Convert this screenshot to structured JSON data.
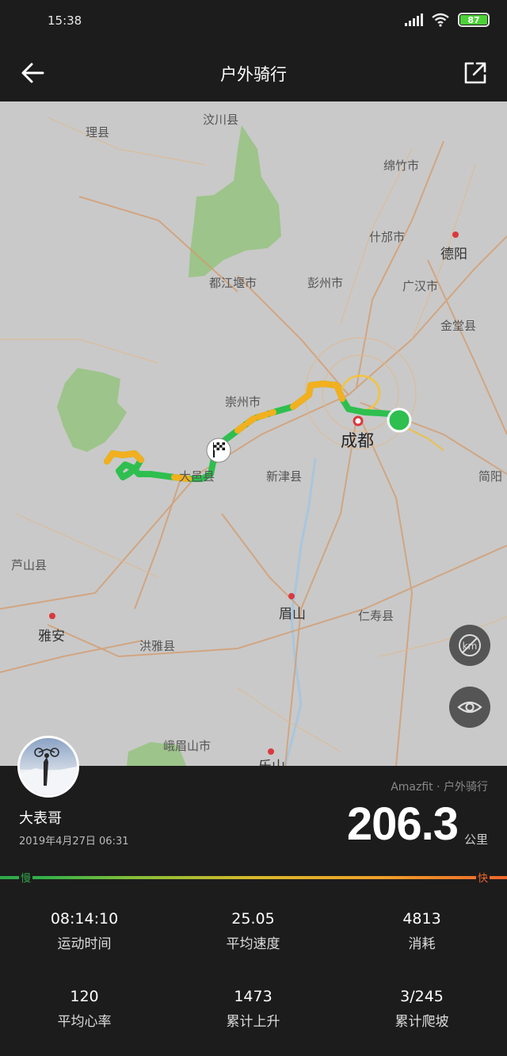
{
  "status": {
    "time": "15:38",
    "battery": "87"
  },
  "app_bar": {
    "title": "户外骑行"
  },
  "map": {
    "labels": {
      "lixian": "理县",
      "wenchuan": "汶川县",
      "mianzhu": "绵竹市",
      "shifang": "什邡市",
      "deyang": "德阳",
      "dujiangyan": "都江堰市",
      "pengzhou": "彭州市",
      "guanghan": "广汉市",
      "jintang": "金堂县",
      "chongzhou": "崇州市",
      "chengdu": "成都",
      "xinjin": "新津县",
      "jianyang": "简阳",
      "dayi": "大邑县",
      "lushan": "芦山县",
      "yaan": "雅安",
      "meishan": "眉山",
      "renshou": "仁寿县",
      "hongya": "洪雅县",
      "emeishan": "峨眉山市",
      "leshan": "乐山"
    }
  },
  "summary": {
    "brand": "Amazfit · 户外骑行",
    "user_name": "大表哥",
    "date": "2019年4月27日 06:31",
    "distance": "206.3",
    "distance_unit": "公里",
    "speed_slow": "慢",
    "speed_fast": "快"
  },
  "stats": [
    {
      "value": "08:14:10",
      "label": "运动时间"
    },
    {
      "value": "25.05",
      "label": "平均速度"
    },
    {
      "value": "4813",
      "label": "消耗"
    },
    {
      "value": "120",
      "label": "平均心率"
    },
    {
      "value": "1473",
      "label": "累计上升"
    },
    {
      "value": "3/245",
      "label": "累计爬坡"
    }
  ],
  "colors": {
    "background": "#1c1c1c",
    "map_bg": "#c9c9c9",
    "park_green": "#9dc48a",
    "route_green": "#2ebf4f",
    "route_orange": "#f2b01e",
    "battery_green": "#4cd137"
  },
  "icons": {
    "back": "arrow-left-icon",
    "share": "share-external-icon",
    "km_marker_toggle": "km-marker-off-icon",
    "view_toggle": "eye-icon",
    "finish": "checkered-flag-icon",
    "start": "start-dot-icon"
  }
}
